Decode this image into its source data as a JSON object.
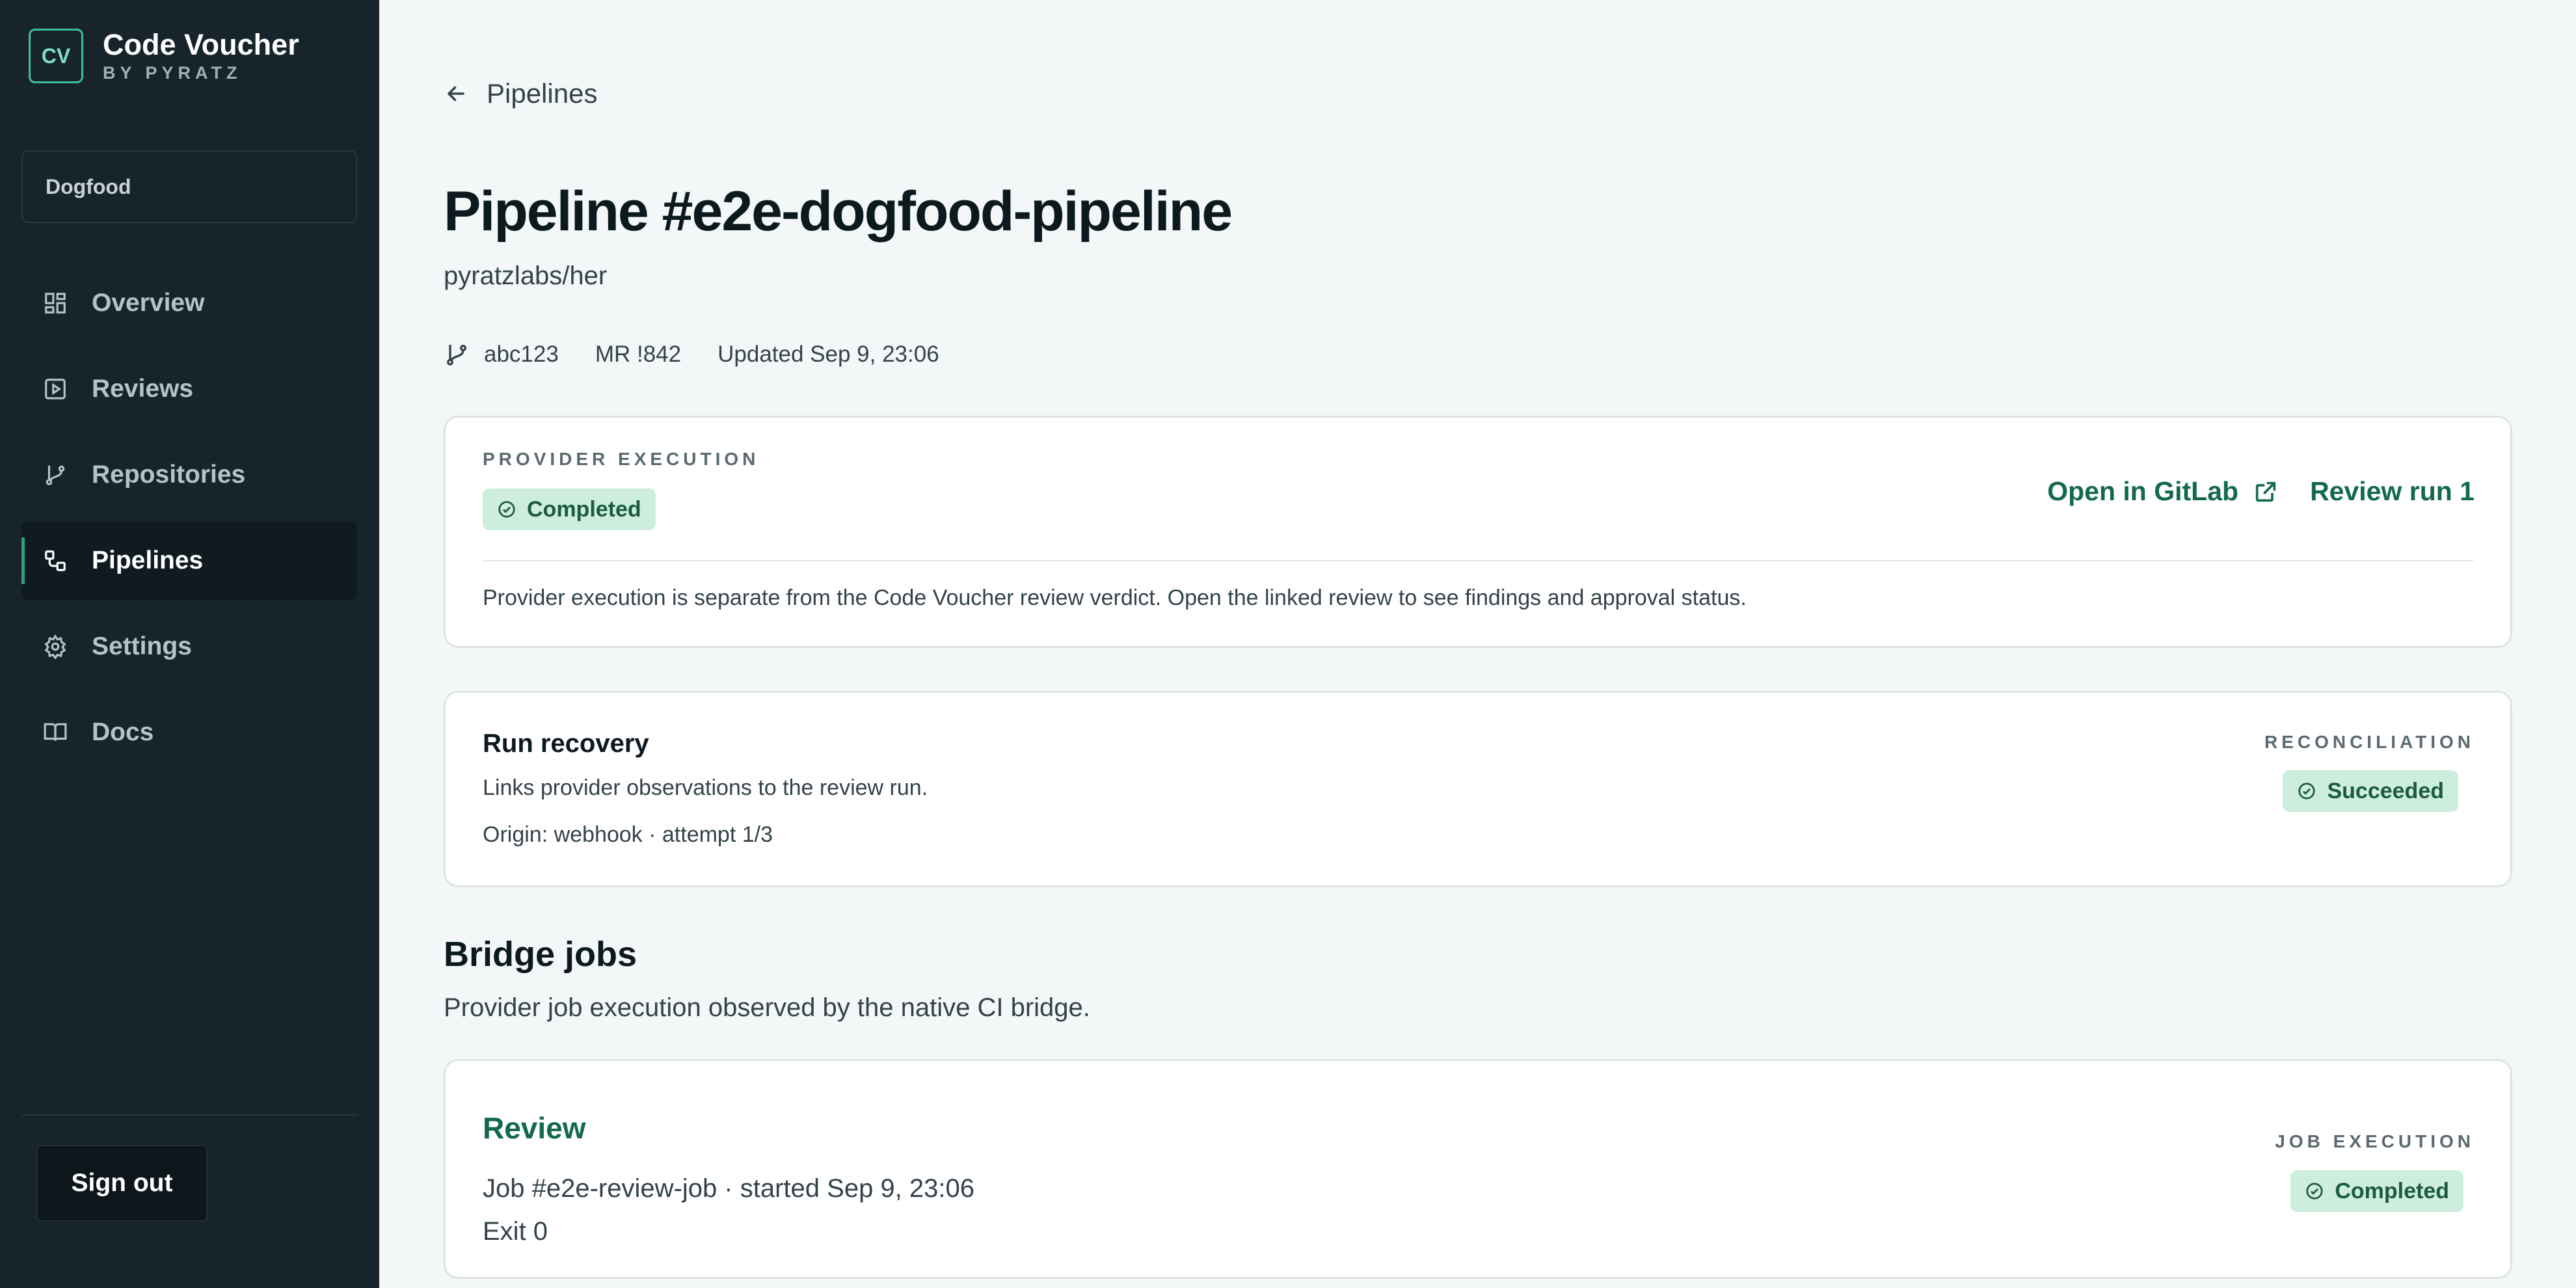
{
  "brand": {
    "logo": "CV",
    "title": "Code Voucher",
    "subtitle": "BY PYRATZ"
  },
  "workspace": {
    "name": "Dogfood"
  },
  "nav": {
    "items": [
      {
        "label": "Overview",
        "icon": "grid-icon",
        "active": false
      },
      {
        "label": "Reviews",
        "icon": "play-square-icon",
        "active": false
      },
      {
        "label": "Repositories",
        "icon": "git-branch-icon",
        "active": false
      },
      {
        "label": "Pipelines",
        "icon": "pipeline-icon",
        "active": true
      },
      {
        "label": "Settings",
        "icon": "gear-icon",
        "active": false
      },
      {
        "label": "Docs",
        "icon": "book-icon",
        "active": false
      }
    ]
  },
  "signout": {
    "label": "Sign out"
  },
  "back": {
    "label": "Pipelines"
  },
  "page": {
    "title": "Pipeline #e2e-dogfood-pipeline",
    "repo": "pyratzlabs/her",
    "meta": {
      "commit": "abc123",
      "mr": "MR !842",
      "updated": "Updated Sep 9, 23:06"
    }
  },
  "provider": {
    "eyebrow": "PROVIDER EXECUTION",
    "status": "Completed",
    "open_link": "Open in GitLab",
    "review_link": "Review run 1",
    "note": "Provider execution is separate from the Code Voucher review verdict. Open the linked review to see findings and approval status."
  },
  "recovery": {
    "title": "Run recovery",
    "description": "Links provider observations to the review run.",
    "origin": "Origin: webhook · attempt 1/3",
    "eyebrow": "RECONCILIATION",
    "status": "Succeeded"
  },
  "bridge": {
    "title": "Bridge jobs",
    "subtitle": "Provider job execution observed by the native CI bridge.",
    "jobs": [
      {
        "name": "Review",
        "line": "Job #e2e-review-job · started Sep 9, 23:06",
        "exit": "Exit 0",
        "eyebrow": "JOB EXECUTION",
        "status": "Completed"
      }
    ]
  },
  "colors": {
    "sidebar": "#17242b",
    "accent": "#13694e",
    "badge_bg": "#cdeedd",
    "badge_text": "#1d5a44"
  }
}
